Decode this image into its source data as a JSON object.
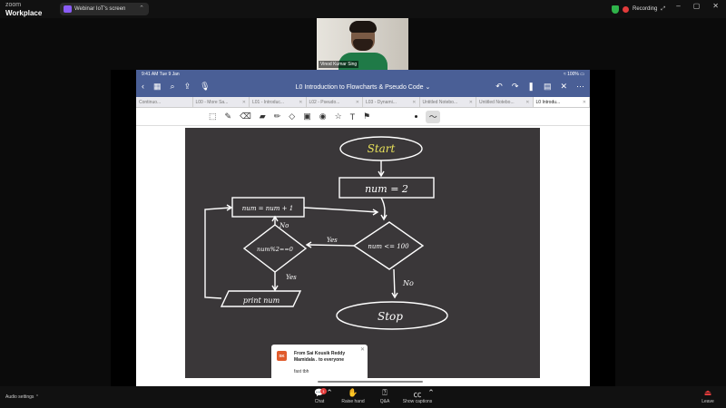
{
  "app": {
    "brand_line1": "zoom",
    "brand_line2": "Workplace"
  },
  "share": {
    "label": "Webinar IoT's screen"
  },
  "recording": {
    "label": "Recording"
  },
  "participant": {
    "name": "Vinod Kumar Sing"
  },
  "ipad": {
    "time": "9:41 AM   Tue 9 Jan",
    "battery": "100%",
    "title": "L0 Introduction to Flowcharts & Pseudo Code",
    "tabs": [
      {
        "label": "Continuo..."
      },
      {
        "label": "L00 - More Sa..."
      },
      {
        "label": "L01 - Introduc..."
      },
      {
        "label": "L02 - Pseudo..."
      },
      {
        "label": "L03 - Dynami..."
      },
      {
        "label": "Untitled Notebo..."
      },
      {
        "label": "Untitled Notebo..."
      },
      {
        "label": "L0 Introdu..."
      }
    ]
  },
  "flowchart": {
    "start": "Start",
    "init": "num = 2",
    "cond1": "num <= 100",
    "cond2": "num%2==0",
    "incr": "num = num + 1",
    "print": "print num",
    "stop": "Stop",
    "yes_a": "Yes",
    "yes_b": "Yes",
    "no_a": "No",
    "no_b": "No"
  },
  "toast": {
    "initials": "SK",
    "from": "From Sai Kousik Reddy Mamidala . to everyone",
    "message": "fast tbh"
  },
  "bottom": {
    "audio": "Audio settings",
    "chat": "Chat",
    "chat_count": "1",
    "raise": "Raise hand",
    "qa": "Q&A",
    "captions": "Show captions",
    "leave": "Leave"
  },
  "colors": {
    "ios_bar": "#4a5f96",
    "board": "#3a3739",
    "start_text": "#e9e25a",
    "record": "#e23b3b",
    "leave": "#e23b3b"
  }
}
